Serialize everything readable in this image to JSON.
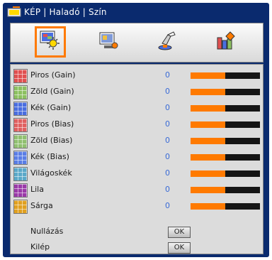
{
  "title": "KÉP | Haladó | Szín",
  "toolbar": {
    "items": [
      {
        "icon": "image-settings-icon",
        "selected": true
      },
      {
        "icon": "display-settings-icon",
        "selected": false
      },
      {
        "icon": "setup-icon",
        "selected": false
      },
      {
        "icon": "options-icon",
        "selected": false
      }
    ]
  },
  "rows": [
    {
      "label": "Piros (Gain)",
      "value": "0",
      "level": 0.5,
      "icon_color": "#e05050"
    },
    {
      "label": "Zöld (Gain)",
      "value": "0",
      "level": 0.5,
      "icon_color": "#8cc060"
    },
    {
      "label": "Kék (Gain)",
      "value": "0",
      "level": 0.5,
      "icon_color": "#4a6ee0"
    },
    {
      "label": "Piros (Bias)",
      "value": "0",
      "level": 0.5,
      "icon_color": "#e06060"
    },
    {
      "label": "Zöld (Bias)",
      "value": "0",
      "level": 0.5,
      "icon_color": "#90c070"
    },
    {
      "label": "Kék (Bias)",
      "value": "0",
      "level": 0.5,
      "icon_color": "#5a7ee6"
    },
    {
      "label": "Világoskék",
      "value": "0",
      "level": 0.5,
      "icon_color": "#5aa8c8"
    },
    {
      "label": "Lila",
      "value": "0",
      "level": 0.5,
      "icon_color": "#9a3aa8"
    },
    {
      "label": "Sárga",
      "value": "0",
      "level": 0.5,
      "icon_color": "#e0a020"
    }
  ],
  "actions": [
    {
      "label": "Nullázás",
      "button": "OK"
    },
    {
      "label": "Kilép",
      "button": "OK"
    }
  ],
  "colors": {
    "accent": "#ff7a00",
    "value_text": "#3a6bd6",
    "window_bg": "#0a2a6e",
    "panel_bg": "#dcdcdc"
  }
}
